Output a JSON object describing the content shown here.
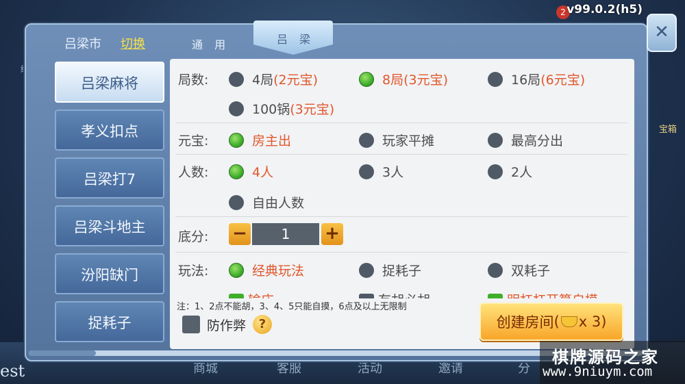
{
  "version": "v99.0.2(h5)",
  "background": {
    "badge": "2",
    "left_label": "绿色",
    "right_label": "宝箱",
    "user_name_fragment": "est",
    "bottom_nav": [
      "商城",
      "客服",
      "活动",
      "邀请",
      "分"
    ]
  },
  "header": {
    "city": "吕梁市",
    "switch": "切换",
    "tab_general": "通 用",
    "tab_active": "吕 梁",
    "close": "✕"
  },
  "sidebar": {
    "items": [
      {
        "label": "吕梁麻将",
        "active": true
      },
      {
        "label": "孝义扣点",
        "active": false
      },
      {
        "label": "吕梁打7",
        "active": false
      },
      {
        "label": "吕梁斗地主",
        "active": false
      },
      {
        "label": "汾阳缺门",
        "active": false
      },
      {
        "label": "捉耗子",
        "active": false
      }
    ]
  },
  "rounds": {
    "label": "局数:",
    "options": [
      {
        "name": "4局",
        "price": "(2元宝)",
        "selected": false
      },
      {
        "name": "8局(3元宝)",
        "price": "",
        "selected": true
      },
      {
        "name": "16局",
        "price": "(6元宝)",
        "selected": false
      },
      {
        "name": "100锅",
        "price": "(3元宝)",
        "selected": false
      }
    ]
  },
  "payment": {
    "label": "元宝:",
    "options": [
      {
        "name": "房主出",
        "selected": true
      },
      {
        "name": "玩家平摊",
        "selected": false
      },
      {
        "name": "最高分出",
        "selected": false
      }
    ]
  },
  "players": {
    "label": "人数:",
    "options": [
      {
        "name": "4人",
        "selected": true
      },
      {
        "name": "3人",
        "selected": false
      },
      {
        "name": "2人",
        "selected": false
      },
      {
        "name": "自由人数",
        "selected": false
      }
    ]
  },
  "base_score": {
    "label": "底分:",
    "minus": "−",
    "value": "1",
    "plus": "+"
  },
  "gameplay": {
    "label": "玩法:",
    "options": [
      {
        "name": "经典玩法",
        "selected": true
      },
      {
        "name": "捉耗子",
        "selected": false
      },
      {
        "name": "双耗子",
        "selected": false
      }
    ],
    "partial_options": [
      "输庄",
      "有胡必胡",
      "明杠杠开算自摸"
    ]
  },
  "note": "注：1、2点不能胡，3、4、5只能自摸，6点及以上无限制",
  "anti_cheat": {
    "label": "防作弊",
    "help": "?"
  },
  "create_button": {
    "label": "创建房间",
    "open_paren": "(",
    "count": "x 3",
    "close_paren": ")"
  },
  "watermark": {
    "line1": "棋牌源码之家",
    "line2": "www.9niuym.com"
  }
}
